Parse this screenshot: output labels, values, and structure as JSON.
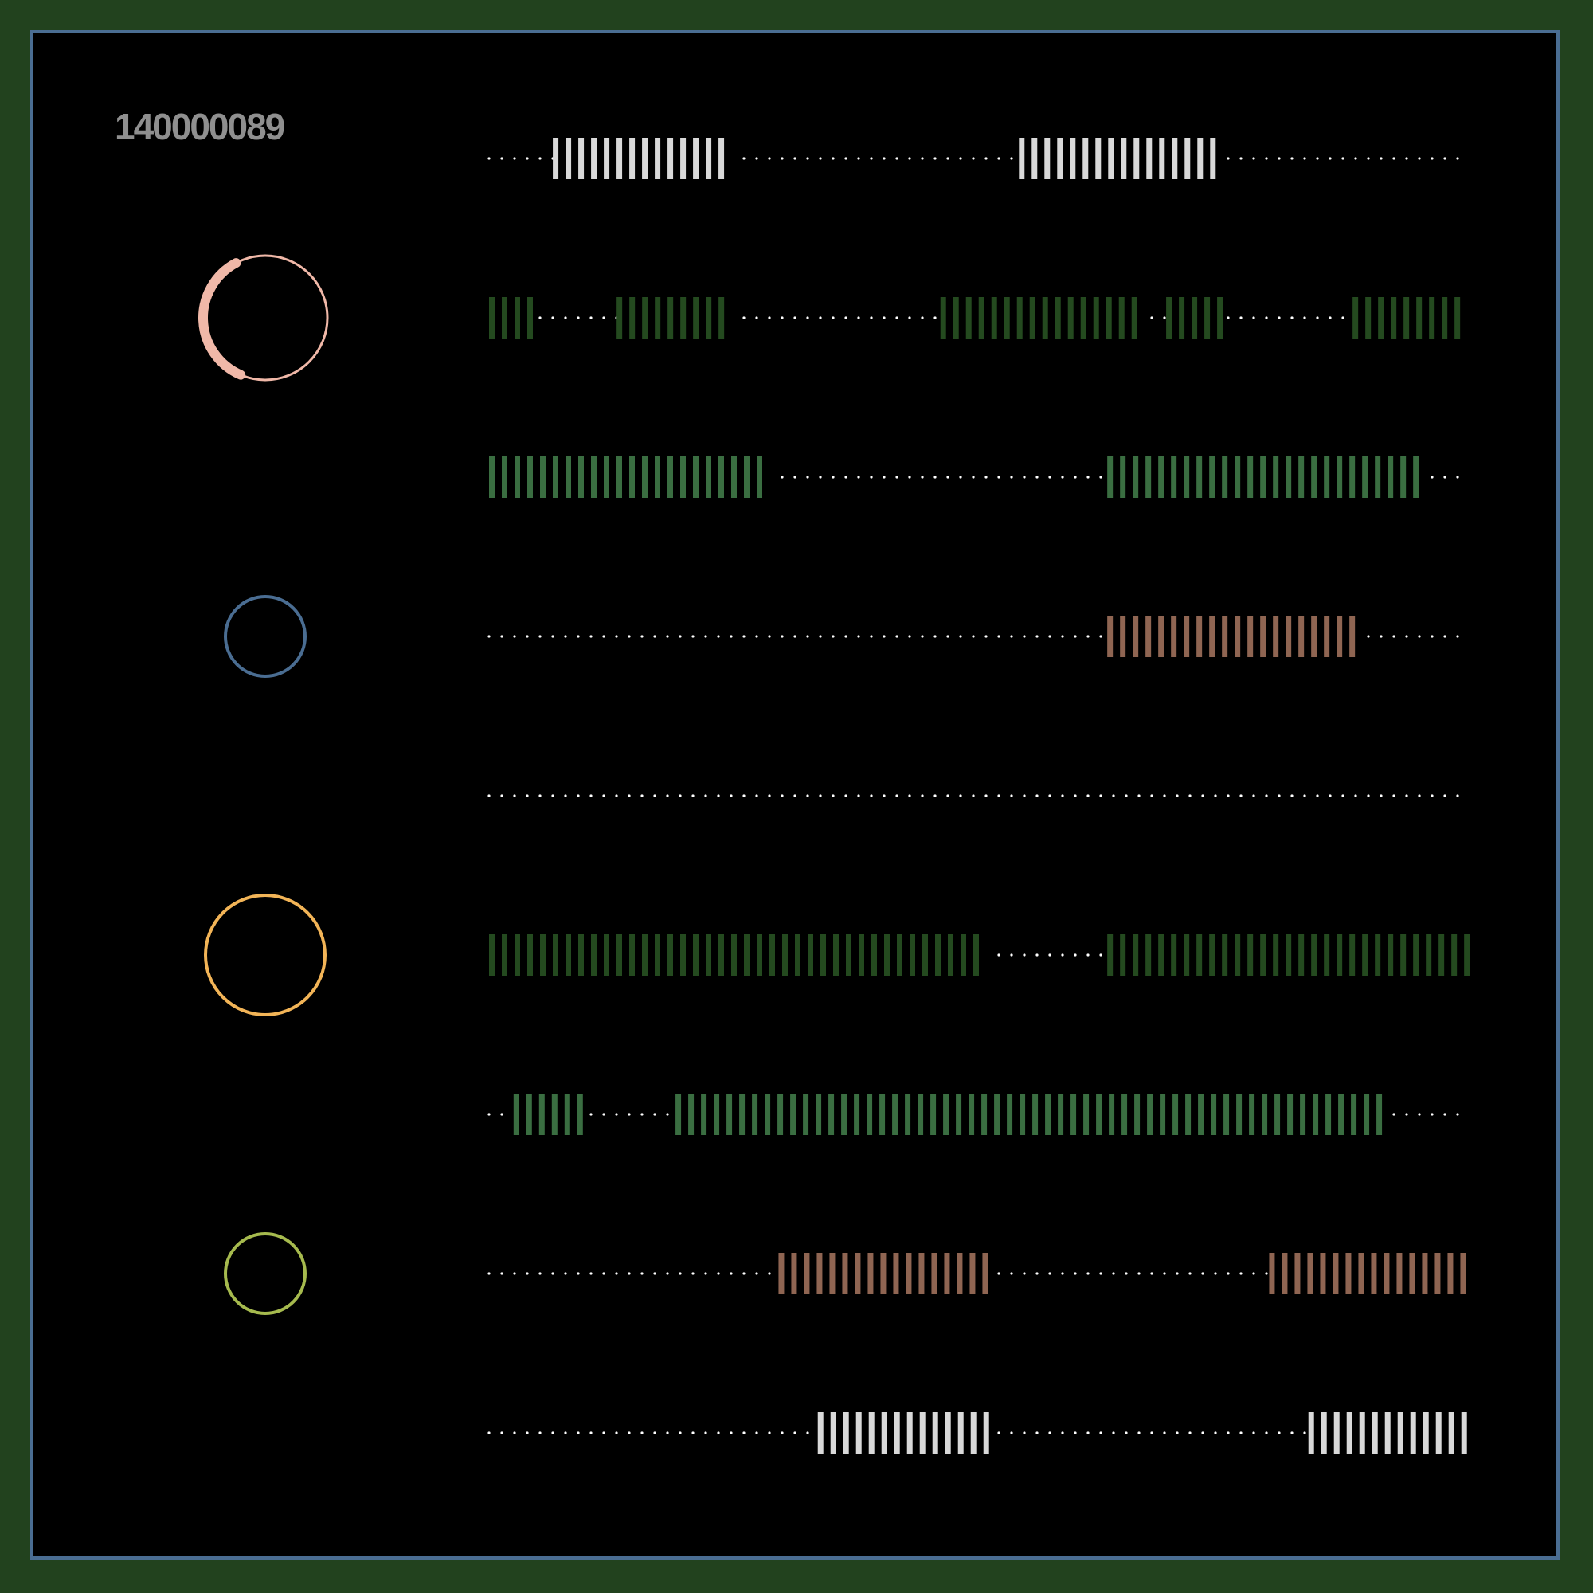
{
  "label": "140000089",
  "colors": {
    "page_bg": "#22421e",
    "frame_border": "#4a6d92",
    "canvas_bg": "#000000",
    "dots": "#ffffff",
    "label": "#8f8f8f",
    "white_bars": "#d9d9d9",
    "dark_green_bars": "#244a1f",
    "green_bars": "#3a6e41",
    "brown_bars": "#8f6552"
  },
  "indicators": [
    {
      "row": 1,
      "color": "#f0b8a8",
      "fill_fraction": 0.65,
      "style": "arc"
    },
    {
      "row": 3,
      "color": "#4a6d92",
      "style": "ring"
    },
    {
      "row": 5,
      "color": "#f2b457",
      "style": "ring"
    },
    {
      "row": 7,
      "color": "#a6ba4e",
      "style": "ring"
    }
  ],
  "rows": [
    {
      "color": "#d9d9d9",
      "segments": [
        [
          0.065,
          0.25
        ],
        [
          0.54,
          0.75
        ]
      ]
    },
    {
      "color": "#244a1f",
      "segments": [
        [
          0.0,
          0.045
        ],
        [
          0.13,
          0.25
        ],
        [
          0.46,
          0.67
        ],
        [
          0.69,
          0.75
        ],
        [
          0.88,
          1.0
        ]
      ]
    },
    {
      "color": "#3a6e41",
      "segments": [
        [
          0.0,
          0.29
        ],
        [
          0.63,
          0.955
        ]
      ]
    },
    {
      "color": "#8f6552",
      "segments": [
        [
          0.63,
          0.89
        ]
      ]
    },
    {
      "color": "#ffffff",
      "segments": []
    },
    {
      "color": "#244a1f",
      "segments": [
        [
          0.0,
          0.51
        ],
        [
          0.63,
          1.0
        ]
      ]
    },
    {
      "color": "#3a6e41",
      "segments": [
        [
          0.025,
          0.095
        ],
        [
          0.19,
          0.92
        ]
      ]
    },
    {
      "color": "#8f6552",
      "segments": [
        [
          0.295,
          0.51
        ],
        [
          0.795,
          1.0
        ]
      ]
    },
    {
      "color": "#d9d9d9",
      "segments": [
        [
          0.335,
          0.51
        ],
        [
          0.835,
          1.0
        ]
      ]
    }
  ]
}
